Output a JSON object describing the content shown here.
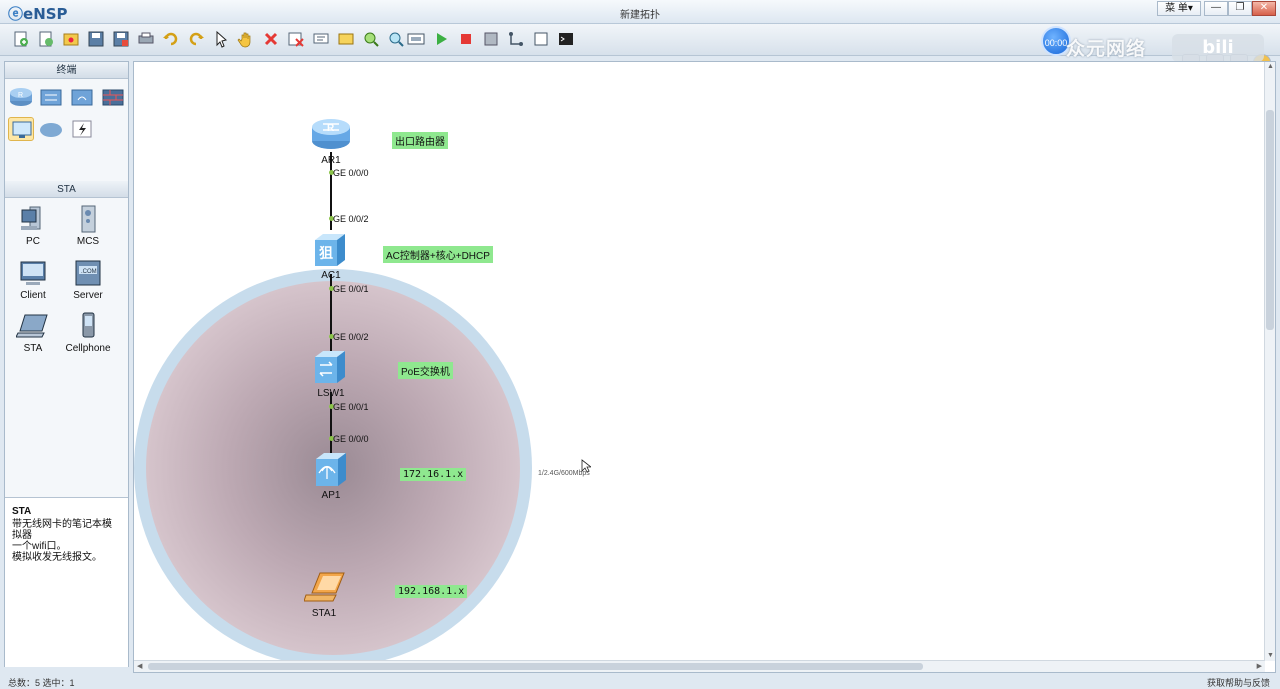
{
  "titlebar": {
    "app_name": "eNSP",
    "window_title": "新建拓扑",
    "menu_label": "菜 单▾",
    "minimize": "—",
    "restore": "❐",
    "close": "✕"
  },
  "toolbar": {
    "tools": [
      "new-topology-icon",
      "new-example-icon",
      "open-icon",
      "save-icon",
      "save-as-icon",
      "print-icon",
      "undo-icon",
      "redo-icon",
      "select-icon",
      "hand-icon",
      "delete-icon",
      "delete-link-icon",
      "text-icon",
      "palette-icon",
      "zoom-in-icon",
      "zoom-out-icon",
      "fit-icon",
      "start-icon",
      "stop-icon",
      "capture-icon",
      "topology-icon",
      "screen-icon",
      "cli-icon"
    ],
    "timer": "00:00",
    "watermark": "众元网络",
    "bili": "bili"
  },
  "left_panel": {
    "terminal_header": "终端",
    "sta_header": "STA",
    "devices": [
      {
        "label": "PC"
      },
      {
        "label": "MCS"
      },
      {
        "label": "Client"
      },
      {
        "label": "Server"
      },
      {
        "label": "STA"
      },
      {
        "label": "Cellphone"
      }
    ],
    "description": {
      "title": "STA",
      "lines": [
        "带无线网卡的笔记本模",
        "拟器",
        "一个wifi口。",
        "模拟收发无线报文。"
      ]
    }
  },
  "topology": {
    "devices": [
      {
        "name": "AR1",
        "type": "router-icon"
      },
      {
        "name": "AC1",
        "type": "ac-icon"
      },
      {
        "name": "LSW1",
        "type": "switch-icon"
      },
      {
        "name": "AP1",
        "type": "ap-icon"
      },
      {
        "name": "STA1",
        "type": "laptop-icon"
      }
    ],
    "ports": [
      "GE 0/0/0",
      "GE 0/0/2",
      "GE 0/0/1",
      "GE 0/0/2",
      "GE 0/0/1",
      "GE 0/0/0"
    ],
    "notes": [
      "出口路由器",
      "AC控制器+核心+DHCP",
      "PoE交换机",
      "172.16.1.x",
      "192.168.1.x"
    ],
    "rate_label": "1/2.4G/600Mbps"
  },
  "statusbar": {
    "left": "总数：5  选中：1",
    "right": "获取帮助与反馈"
  },
  "colors": {
    "note_bg": "#8fe88f",
    "wifi_ring": "#c7dcec",
    "port_dot": "#8bc34a"
  }
}
